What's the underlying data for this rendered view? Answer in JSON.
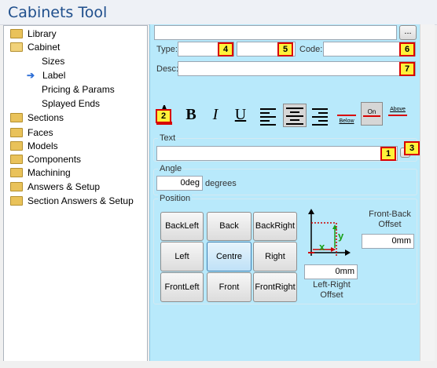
{
  "window": {
    "title": "Cabinets Tool"
  },
  "tree": [
    {
      "label": "Library",
      "icon": "folder-icon"
    },
    {
      "label": "Cabinet",
      "icon": "open-folder-icon"
    },
    {
      "label": "Sizes",
      "icon": ""
    },
    {
      "label": "Label",
      "icon": "arrow-right-icon"
    },
    {
      "label": "Pricing & Params",
      "icon": ""
    },
    {
      "label": "Splayed Ends",
      "icon": ""
    },
    {
      "label": "Sections",
      "icon": "folder-icon"
    },
    {
      "label": "Faces",
      "icon": "folder-icon"
    },
    {
      "label": "Models",
      "icon": "folder-icon"
    },
    {
      "label": "Components",
      "icon": "folder-icon"
    },
    {
      "label": "Machining",
      "icon": "folder-icon"
    },
    {
      "label": "Answers & Setup",
      "icon": "folder-icon"
    },
    {
      "label": "Section Answers & Setup",
      "icon": "folder-icon"
    }
  ],
  "header_fields": {
    "browse_button": "...",
    "type_label": "Type:",
    "code_label": "Code:",
    "desc_label": "Desc:"
  },
  "badges": {
    "b1": "1",
    "b2": "2",
    "b3": "3",
    "b4": "4",
    "b5": "5",
    "b6": "6",
    "b7": "7"
  },
  "toolbar": {
    "bold": "B",
    "italic": "I",
    "underline": "U",
    "below_label": "Below",
    "on_label": "On",
    "above_label": "Above"
  },
  "text_group": {
    "title": "Text",
    "value": ""
  },
  "angle_group": {
    "title": "Angle",
    "value": "0deg",
    "unit": "degrees"
  },
  "position_group": {
    "title": "Position",
    "buttons": [
      "BackLeft",
      "Back",
      "BackRight",
      "Left",
      "Centre",
      "Right",
      "FrontLeft",
      "Front",
      "FrontRight"
    ],
    "selected": "Centre",
    "front_back_label": "Front-Back Offset",
    "front_back_value": "0mm",
    "left_right_label": "Left-Right Offset",
    "left_right_value": "0mm",
    "diagram_x": "x",
    "diagram_y": "y"
  }
}
